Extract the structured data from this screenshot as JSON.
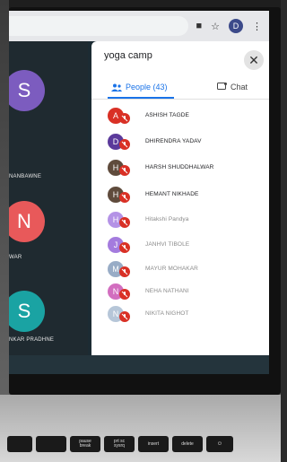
{
  "meeting": {
    "title": "yoga camp",
    "close_glyph": "✕"
  },
  "tabs": {
    "people": "People (43)",
    "chat": "Chat"
  },
  "browser": {
    "profile_initial": "D"
  },
  "tiles": [
    {
      "initial": "S",
      "name": "NANBAWNE",
      "color": "#7c5cbf"
    },
    {
      "initial": "N",
      "name": "WAR",
      "color": "#e8595a"
    },
    {
      "initial": "S",
      "name": "NKAR PRADHNE",
      "color": "#1aa3a3"
    }
  ],
  "participants": [
    {
      "initial": "A",
      "name": "ASHISH TAGDE",
      "color": "#d93025"
    },
    {
      "initial": "D",
      "name": "DHIRENDRA YADAV",
      "color": "#5b3a9b"
    },
    {
      "initial": "H",
      "name": "HARSH SHUDDHALWAR",
      "color": "#5f4b3c"
    },
    {
      "initial": "H",
      "name": "HEMANT NIKHADE",
      "color": "#5f4b3c"
    },
    {
      "initial": "H",
      "name": "Hitakshi Pandya",
      "color": "#a277e0"
    },
    {
      "initial": "J",
      "name": "JANHVI TIBOLE",
      "color": "#8e5bd6"
    },
    {
      "initial": "M",
      "name": "MAYUR MOHAKAR",
      "color": "#7f98b8"
    },
    {
      "initial": "N",
      "name": "NEHA NATHANI",
      "color": "#c84bb0"
    },
    {
      "initial": "N",
      "name": "NIKITA NIGHOT",
      "color": "#a5b8cf"
    }
  ],
  "keyboard": {
    "keys": [
      "",
      "",
      "pause\nbreak",
      "prt sc\nsysrq",
      "insert",
      "delete",
      "⏻"
    ]
  }
}
